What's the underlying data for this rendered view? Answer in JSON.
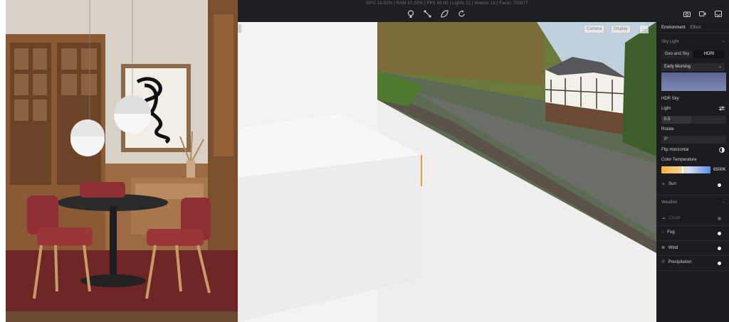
{
  "viewport": {
    "stats": "GPU 18.82%  |  RAM 47.92%  |  FPS 60.00  |  Lights 11  |  Models 16  |  Faces 700877",
    "toolbar_icons": [
      "lightbulb-icon",
      "connect-icon",
      "leaf-icon",
      "rotate-icon"
    ],
    "top_right_buttons": [
      "Camera",
      "Display",
      "..."
    ]
  },
  "top_right_icons": [
    "camera-icon",
    "video-icon",
    "render-icon"
  ],
  "panel": {
    "tabs": [
      "Environment",
      "Effect"
    ],
    "sky_light": {
      "title": "Sky Light",
      "modes": [
        "Geo and Sky",
        "HDRI"
      ],
      "selected_mode": "HDRI",
      "preset": "Early Morning",
      "hdr_title": "HDR Sky",
      "light_label": "Light",
      "light_value": "0.5",
      "rotate_label": "Rotate",
      "rotate_value": "0°",
      "flip_label": "Flip Horizontal",
      "color_temp_label": "Color Temperature",
      "color_temp_value": "6500K",
      "sun_label": "Sun"
    },
    "weather": {
      "title": "Weather",
      "items": [
        {
          "label": "Cloud",
          "enabled": false
        },
        {
          "label": "Fog",
          "enabled": true
        },
        {
          "label": "Wind",
          "enabled": true
        },
        {
          "label": "Precipitation",
          "enabled": true
        }
      ]
    }
  }
}
